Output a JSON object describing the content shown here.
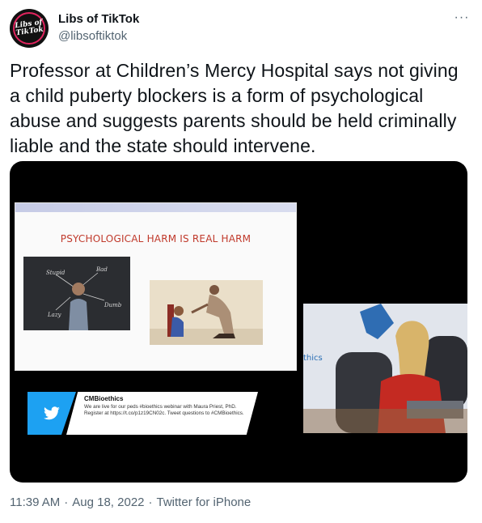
{
  "author": {
    "name": "Libs of TikTok",
    "handle": "@libsoftiktok",
    "avatar_text": "Libs of TikTok"
  },
  "more_icon": "more-horizontal-icon",
  "more_label": "···",
  "tweet": {
    "text": "Professor at Children’s Mercy Hospital says not giving a child puberty blockers is a form of psychological abuse and suggests parents should be held criminally liable and the state should intervene."
  },
  "media": {
    "slide_title": "PSYCHOLOGICAL HARM IS REAL HARM",
    "chalk_words": [
      "Bad",
      "Stupid",
      "Dumb",
      "Lazy"
    ],
    "social": {
      "name": "CMBioethics",
      "text": "We are live for our peds #bioethics webinar with Maura Priest, PhD. Register at https://t.co/p1z19CN02c. Tweet questions to #CMBioethics."
    },
    "webcam_sign": "thics"
  },
  "meta": {
    "time": "11:39 AM",
    "date": "Aug 18, 2022",
    "source": "Twitter for iPhone"
  },
  "colors": {
    "text": "#0f1419",
    "secondary": "#536471",
    "twitter_blue": "#1da1f2",
    "slide_title": "#c0392b"
  }
}
